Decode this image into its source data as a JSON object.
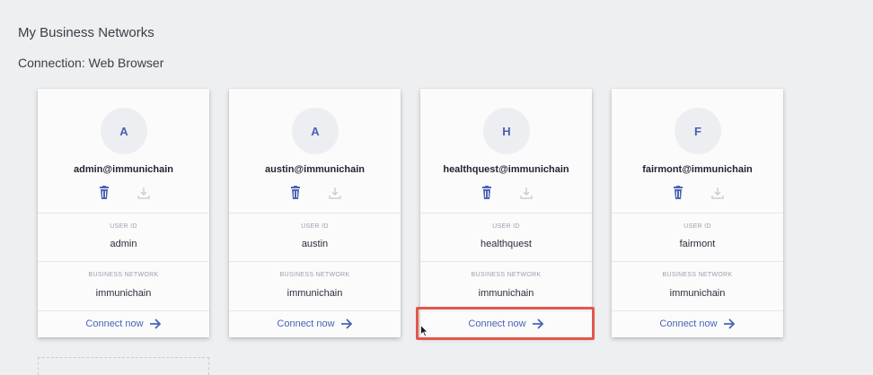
{
  "header": {
    "title": "My Business Networks",
    "connection": "Connection: Web Browser"
  },
  "labels": {
    "user_id": "USER ID",
    "business_network": "BUSINESS NETWORK",
    "connect": "Connect now"
  },
  "cards": [
    {
      "initial": "A",
      "name": "admin@immunichain",
      "user_id": "admin",
      "network": "immunichain"
    },
    {
      "initial": "A",
      "name": "austin@immunichain",
      "user_id": "austin",
      "network": "immunichain"
    },
    {
      "initial": "H",
      "name": "healthquest@immunichain",
      "user_id": "healthquest",
      "network": "immunichain"
    },
    {
      "initial": "F",
      "name": "fairmont@immunichain",
      "user_id": "fairmont",
      "network": "immunichain"
    }
  ],
  "colors": {
    "accent": "#4a63b5",
    "highlight": "#e2574c",
    "background": "#eeeff1",
    "card": "#fbfbfc"
  },
  "icons": {
    "delete": "trash-icon",
    "export": "download-icon",
    "connect": "arrow-right-icon"
  }
}
